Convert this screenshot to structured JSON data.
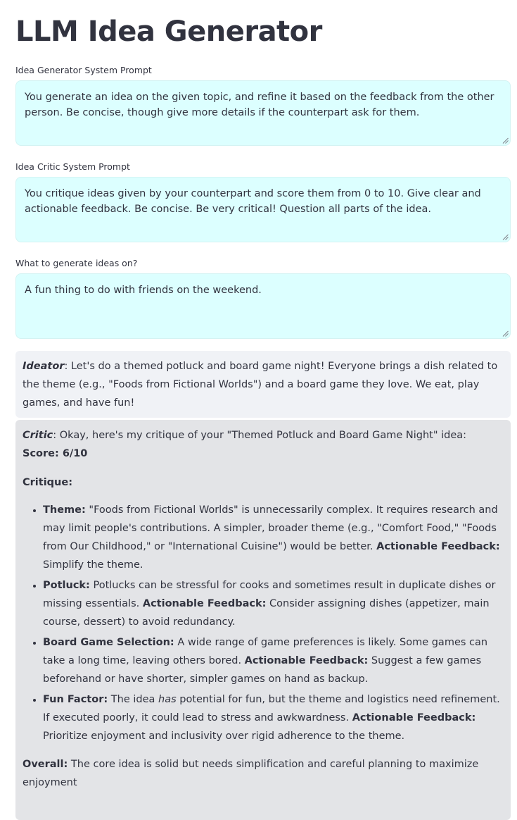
{
  "app": {
    "title": "LLM Idea Generator"
  },
  "fields": [
    {
      "label": "Idea Generator System Prompt",
      "value": "You generate an idea on the given topic, and refine it based on the feedback from the other person. Be concise, though give more details if the counterpart ask for them."
    },
    {
      "label": "Idea Critic System Prompt",
      "value": "You critique ideas given by your counterpart and score them from 0 to 10. Give clear and actionable feedback. Be concise. Be very critical! Question all parts of the idea."
    },
    {
      "label": "What to generate ideas on?",
      "value": "A fun thing to do with friends on the weekend."
    }
  ],
  "chat": {
    "ideator": {
      "speaker": "Ideator",
      "text": ": Let's do a themed potluck and board game night! Everyone brings a dish related to the theme (e.g., \"Foods from Fictional Worlds\") and a board game they love. We eat, play games, and have fun!"
    },
    "critic": {
      "speaker": "Critic",
      "intro": ": Okay, here's my critique of your \"Themed Potluck and Board Game Night\" idea:",
      "score": "Score: 6/10",
      "critique_heading": "Critique:",
      "points": [
        {
          "heading": "Theme:",
          "text": " \"Foods from Fictional Worlds\" is unnecessarily complex. It requires research and may limit people's contributions. A simpler, broader theme (e.g., \"Comfort Food,\" \"Foods from Our Childhood,\" or \"International Cuisine\") would be better. ",
          "action_label": "Actionable Feedback:",
          "action": " Simplify the theme."
        },
        {
          "heading": "Potluck:",
          "text": " Potlucks can be stressful for cooks and sometimes result in duplicate dishes or missing essentials. ",
          "action_label": "Actionable Feedback:",
          "action": " Consider assigning dishes (appetizer, main course, dessert) to avoid redundancy."
        },
        {
          "heading": "Board Game Selection:",
          "text": " A wide range of game preferences is likely. Some games can take a long time, leaving others bored. ",
          "action_label": "Actionable Feedback:",
          "action": " Suggest a few games beforehand or have shorter, simpler games on hand as backup."
        },
        {
          "heading": "Fun Factor:",
          "text_before": " The idea ",
          "emphasis": "has",
          "text_after": " potential for fun, but the theme and logistics need refinement. If executed poorly, it could lead to stress and awkwardness. ",
          "action_label": "Actionable Feedback:",
          "action": " Prioritize enjoyment and inclusivity over rigid adherence to the theme."
        }
      ],
      "overall_label": "Overall:",
      "overall_text": " The core idea is solid but needs simplification and careful planning to maximize enjoyment"
    }
  },
  "colors": {
    "text": "#31333f",
    "textarea_bg": "#dcffff",
    "ideator_bg": "#f0f2f6",
    "critic_bg": "#e3e4e7"
  }
}
